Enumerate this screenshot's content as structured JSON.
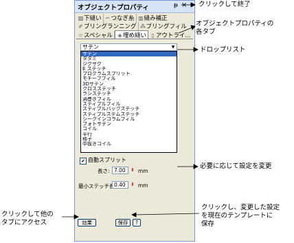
{
  "panel": {
    "title": "オブジェクトプロパティ",
    "pin_glyph": "ᵽ",
    "close_glyph": "×",
    "tabs_row1": [
      "下縫い",
      "つなぎ糸",
      "縫み補正"
    ],
    "tabs_row2": [
      "ブリングランニング",
      "ブリングフィル"
    ],
    "tabs_row3": [
      "スペシャル",
      "埋め縫い",
      "アウトライ..."
    ],
    "combo_value": "サテン",
    "dropdown_options": [
      "サテン",
      "タタミ",
      "ジグザグ",
      "E ステッチ",
      "プログラムスプリット",
      "モチーフフィル",
      "3Dサテン",
      "クロスステッチ",
      "ラシステッチ",
      "渦巻きフィル",
      "スティプルフィル",
      "スティプルバックステッチ",
      "スティプルステムステッチ",
      "シークインコラムフィル",
      "フォトサテン",
      "コイル",
      "平行",
      "格子",
      "中抜きコイル"
    ],
    "selected_index": 0,
    "auto_split_label": "自動スプリット",
    "auto_split_checked": true,
    "length_label": "長さ:",
    "length_value": "7.00",
    "min_stitch_label": "最小ステッチ長:",
    "min_stitch_value": "0.40",
    "unit": "mm",
    "effects_button": "効果",
    "save_button": "保存",
    "help_button": "?"
  },
  "callouts": {
    "close": "クリックして終了",
    "tabs_line1": "オブジェクトプロパティの",
    "tabs_line2": "各タブ",
    "droplist": "ドロップリスト",
    "settings": "必要に応じて設定を変更",
    "other_tabs_line1": "クリックして他の",
    "other_tabs_line2": "タブにアクセス",
    "save_line1": "クリックし、変更した設定",
    "save_line2": "を現在のテンプレートに",
    "save_line3": "保存"
  }
}
